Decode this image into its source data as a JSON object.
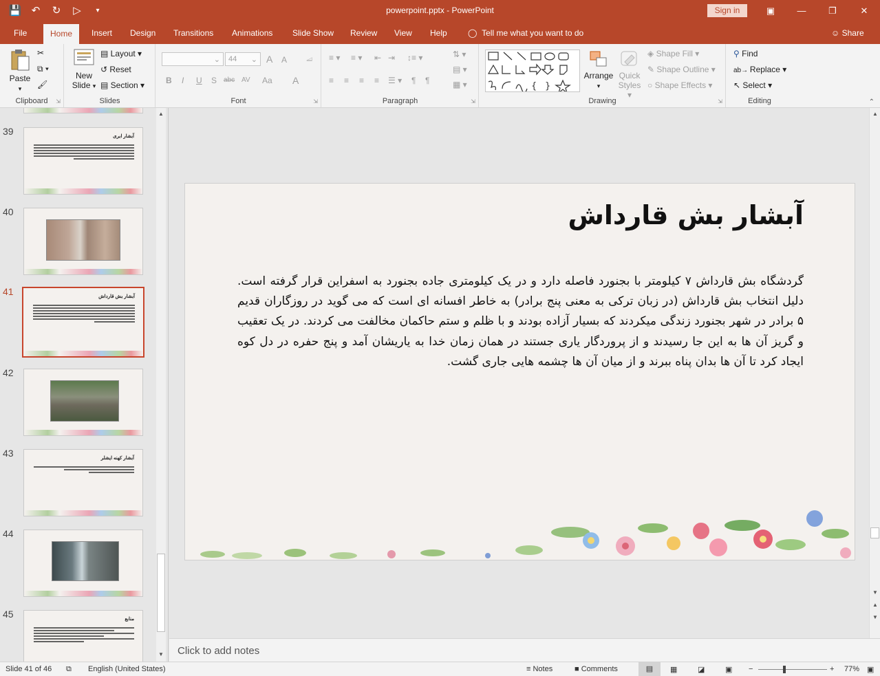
{
  "window": {
    "title": "powerpoint.pptx  -  PowerPoint",
    "sign_in": "Sign in",
    "accent": "#b7472a"
  },
  "tabs": [
    {
      "label": "File"
    },
    {
      "label": "Home"
    },
    {
      "label": "Insert"
    },
    {
      "label": "Design"
    },
    {
      "label": "Transitions"
    },
    {
      "label": "Animations"
    },
    {
      "label": "Slide Show"
    },
    {
      "label": "Review"
    },
    {
      "label": "View"
    },
    {
      "label": "Help"
    }
  ],
  "tell_me": "Tell me what you want to do",
  "share": "Share",
  "ribbon": {
    "clipboard": {
      "paste": "Paste",
      "label": "Clipboard"
    },
    "slides": {
      "new_slide_1": "New",
      "new_slide_2": "Slide",
      "layout": "Layout",
      "reset": "Reset",
      "section": "Section",
      "label": "Slides"
    },
    "font": {
      "size": "44",
      "label": "Font",
      "bold": "B",
      "italic": "I",
      "underline": "U",
      "shadow": "S",
      "strike": "abc",
      "spacing": "AV",
      "case": "Aa",
      "color": "A",
      "grow": "A",
      "shrink": "A"
    },
    "paragraph": {
      "label": "Paragraph"
    },
    "drawing": {
      "arrange": "Arrange",
      "quick_styles_1": "Quick",
      "quick_styles_2": "Styles",
      "shape_fill": "Shape Fill",
      "shape_outline": "Shape Outline",
      "shape_effects": "Shape Effects",
      "label": "Drawing"
    },
    "editing": {
      "find": "Find",
      "replace": "Replace",
      "select": "Select",
      "label": "Editing"
    }
  },
  "thumbnails": [
    {
      "num": "39",
      "title": "آبشار ابری"
    },
    {
      "num": "40"
    },
    {
      "num": "41",
      "title": "آبشار بش قارداش",
      "active": true
    },
    {
      "num": "42"
    },
    {
      "num": "43",
      "title": "آبشار کهنه ایشلر"
    },
    {
      "num": "44"
    },
    {
      "num": "45",
      "title": "منابع"
    }
  ],
  "slide": {
    "title": "آبشار بش قارداش",
    "body": "گردشگاه بش قارداش ۷ کیلومتر با بجنورد فاصله دارد و در یک کیلومتری جاده بجنورد به اسفراین قرار گرفته است. دلیل انتخاب بش قارداش (در زبان ترکی به معنی پنج برادر) به خاطر افسانه ای است که می گوید در روزگاران قدیم ۵ برادر در  شهر بجنورد زندگی میکردند که بسیار آزاده بودند و با ظلم و ستم حاکمان مخالفت می کردند. در یک تعقیب و گریز آن ها به این جا رسیدند و از پروردگار یاری جستند در همان زمان خدا به یاریشان آمد و پنج حفره در دل کوه ایجاد کرد تا آن ها بدان پناه ببرند و از میان آن ها چشمه هایی جاری گشت."
  },
  "notes_placeholder": "Click to add notes",
  "status": {
    "slide_of": "Slide 41 of 46",
    "language": "English (United States)",
    "notes": "Notes",
    "comments": "Comments",
    "zoom": "77%",
    "zoom_level": 0.5
  }
}
